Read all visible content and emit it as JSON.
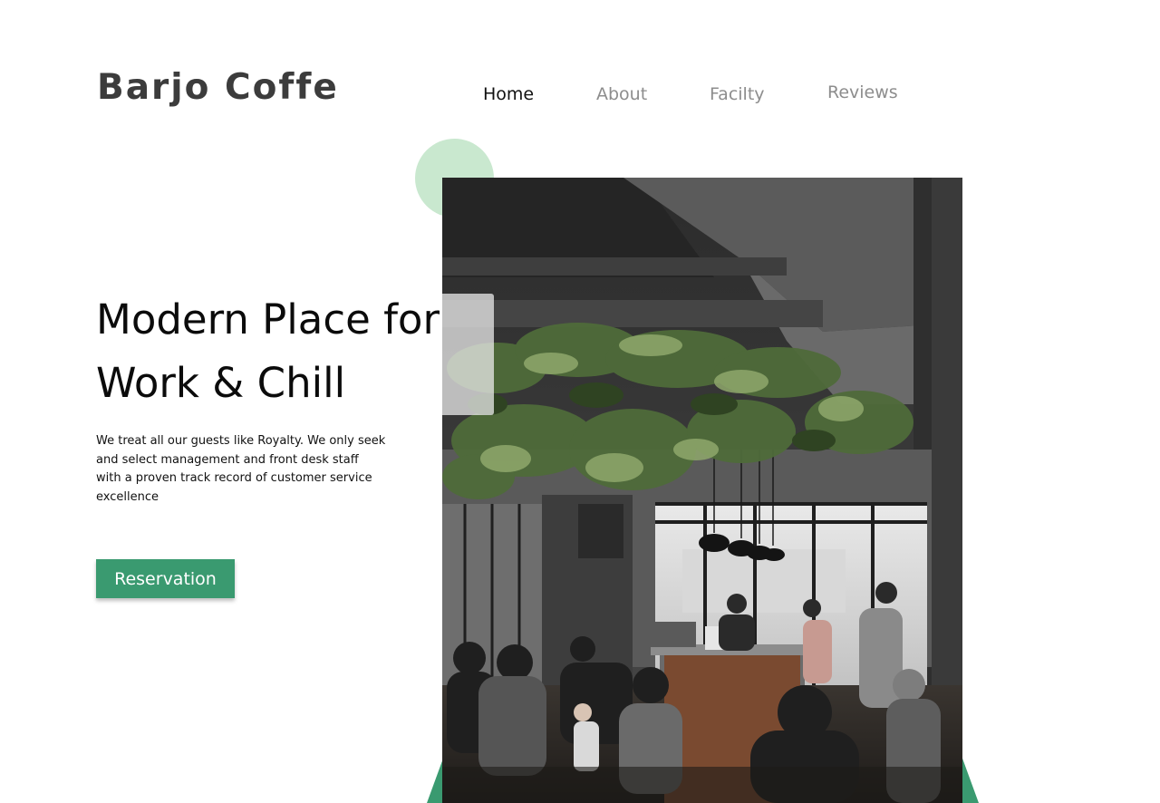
{
  "brand": {
    "name": "Barjo Coffe"
  },
  "nav": {
    "items": [
      {
        "label": "Home",
        "active": true
      },
      {
        "label": "About",
        "active": false
      },
      {
        "label": "Facilty",
        "active": false
      },
      {
        "label": "Reviews",
        "active": false
      }
    ]
  },
  "hero": {
    "title_line1": "Modern Place for",
    "title_line2": "Work & Chill",
    "description": "We treat all our guests like Royalty.  We only seek and select management and front desk staff with a proven track record of customer service excellence",
    "cta_label": "Reservation"
  },
  "colors": {
    "accent": "#3a9a70",
    "accent_light": "#c9e8cf",
    "nav_inactive": "#8d8d8d",
    "text": "#111111"
  }
}
